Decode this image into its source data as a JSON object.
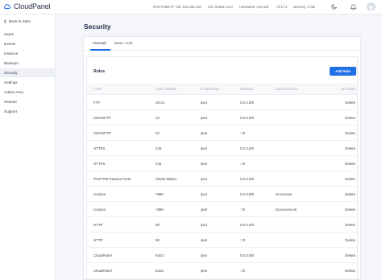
{
  "header": {
    "brand": "CloudPanel",
    "info": [
      "IPv4 Public IP: 167.235.198.118",
      "OS: Debian 11.8",
      "Hostname: cpn-test",
      "CPU: 2",
      "Memory: 2 GB"
    ]
  },
  "sidebar": {
    "back_label": "Back to Sites",
    "items": [
      {
        "label": "Users"
      },
      {
        "label": "Events"
      },
      {
        "label": "Instance"
      },
      {
        "label": "Backups"
      },
      {
        "label": "Security",
        "active": true
      },
      {
        "label": "Settings"
      },
      {
        "label": "Admin Area"
      },
      {
        "label": "Hetzner"
      },
      {
        "label": "Support"
      }
    ]
  },
  "page": {
    "title": "Security",
    "tabs": [
      {
        "label": "Firewall",
        "active": true
      },
      {
        "label": "Basic Auth"
      }
    ]
  },
  "rules": {
    "title": "Rules",
    "add_button": "Add Rule",
    "columns": [
      "TYPE",
      "PORT RANGE",
      "IP VERSION",
      "SOURCE",
      "DESCRIPTION",
      "ACTIONS"
    ],
    "rows": [
      {
        "type": "FTP",
        "port": "20-21",
        "ip": "ipv4",
        "source": "0.0.0.0/0",
        "description": "",
        "action": "Delete"
      },
      {
        "type": "SSH/SFTP",
        "port": "22",
        "ip": "ipv4",
        "source": "0.0.0.0/0",
        "description": "",
        "action": "Delete"
      },
      {
        "type": "SSH/SFTP",
        "port": "22",
        "ip": "ipv6",
        "source": "::/0",
        "description": "",
        "action": "Delete"
      },
      {
        "type": "HTTPS",
        "port": "443",
        "ip": "ipv4",
        "source": "0.0.0.0/0",
        "description": "",
        "action": "Delete"
      },
      {
        "type": "HTTPS",
        "port": "443",
        "ip": "ipv6",
        "source": "::/0",
        "description": "",
        "action": "Delete"
      },
      {
        "type": "ProFTPD Passive Ports",
        "port": "49152-65534",
        "ip": "ipv4",
        "source": "0.0.0.0/0",
        "description": "",
        "action": "Delete"
      },
      {
        "type": "Custom",
        "port": "7890",
        "ip": "ipv4",
        "source": "0.0.0.0/0",
        "description": "GoAccess",
        "action": "Delete"
      },
      {
        "type": "Custom",
        "port": "7890",
        "ip": "ipv6",
        "source": "::/0",
        "description": "GoAccess-v6",
        "action": "Delete"
      },
      {
        "type": "HTTP",
        "port": "80",
        "ip": "ipv4",
        "source": "0.0.0.0/0",
        "description": "",
        "action": "Delete"
      },
      {
        "type": "HTTP",
        "port": "80",
        "ip": "ipv6",
        "source": "::/0",
        "description": "",
        "action": "Delete"
      },
      {
        "type": "CloudPanel",
        "port": "8443",
        "ip": "ipv4",
        "source": "0.0.0.0/0",
        "description": "",
        "action": "Delete"
      },
      {
        "type": "CloudPanel",
        "port": "8443",
        "ip": "ipv6",
        "source": "::/0",
        "description": "",
        "action": "Delete"
      }
    ]
  },
  "colors": {
    "accent": "#1f6fe5",
    "sidebar_active": "#eceff4"
  }
}
